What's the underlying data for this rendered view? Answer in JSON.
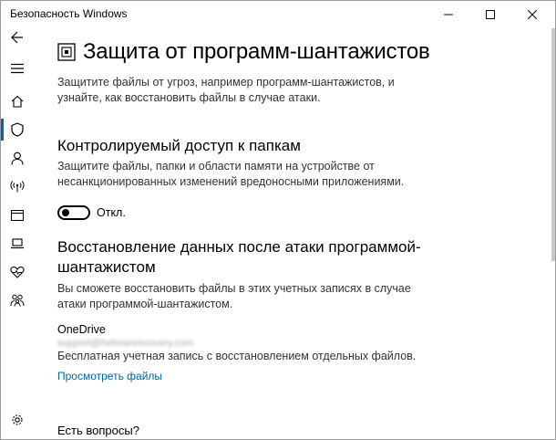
{
  "window": {
    "title": "Безопасность Windows"
  },
  "page": {
    "title": "Защита от программ-шантажистов",
    "desc_lines": [
      "Защитите файлы от угроз, например программ-шантажистов, и",
      "узнайте, как восстановить файлы в случае атаки."
    ]
  },
  "cfa": {
    "heading": "Контролируемый доступ к папкам",
    "desc_lines": [
      "Защитите файлы, папки и области памяти на устройстве от",
      "несанкционированных изменений вредоносными приложениями."
    ],
    "toggle_label": "Откл.",
    "toggle_on": false
  },
  "recovery": {
    "heading_lines": [
      "Восстановление данных после атаки программой-",
      "шантажистом"
    ],
    "desc_lines": [
      "Вы сможете восстановить файлы в этих учетных записях в случае",
      "атаки программой-шантажистом."
    ],
    "service": "OneDrive",
    "account": "support@hetmanrecovery.com",
    "account_desc": "Бесплатная учетная запись с восстановлением отдельных файлов.",
    "view_files_link": "Просмотреть файлы"
  },
  "questions": {
    "heading": "Есть вопросы?"
  },
  "sidebar": {
    "items": [
      {
        "icon": "back-arrow-icon"
      },
      {
        "icon": "hamburger-menu-icon"
      },
      {
        "icon": "home-icon"
      },
      {
        "icon": "shield-icon",
        "active": true
      },
      {
        "icon": "person-icon"
      },
      {
        "icon": "wireless-icon"
      },
      {
        "icon": "app-browser-icon"
      },
      {
        "icon": "laptop-icon"
      },
      {
        "icon": "heart-icon"
      },
      {
        "icon": "family-icon"
      },
      {
        "icon": "gear-icon"
      }
    ]
  },
  "colors": {
    "accent": "#0063b1",
    "text": "#000000",
    "secondary_text": "#333333"
  }
}
